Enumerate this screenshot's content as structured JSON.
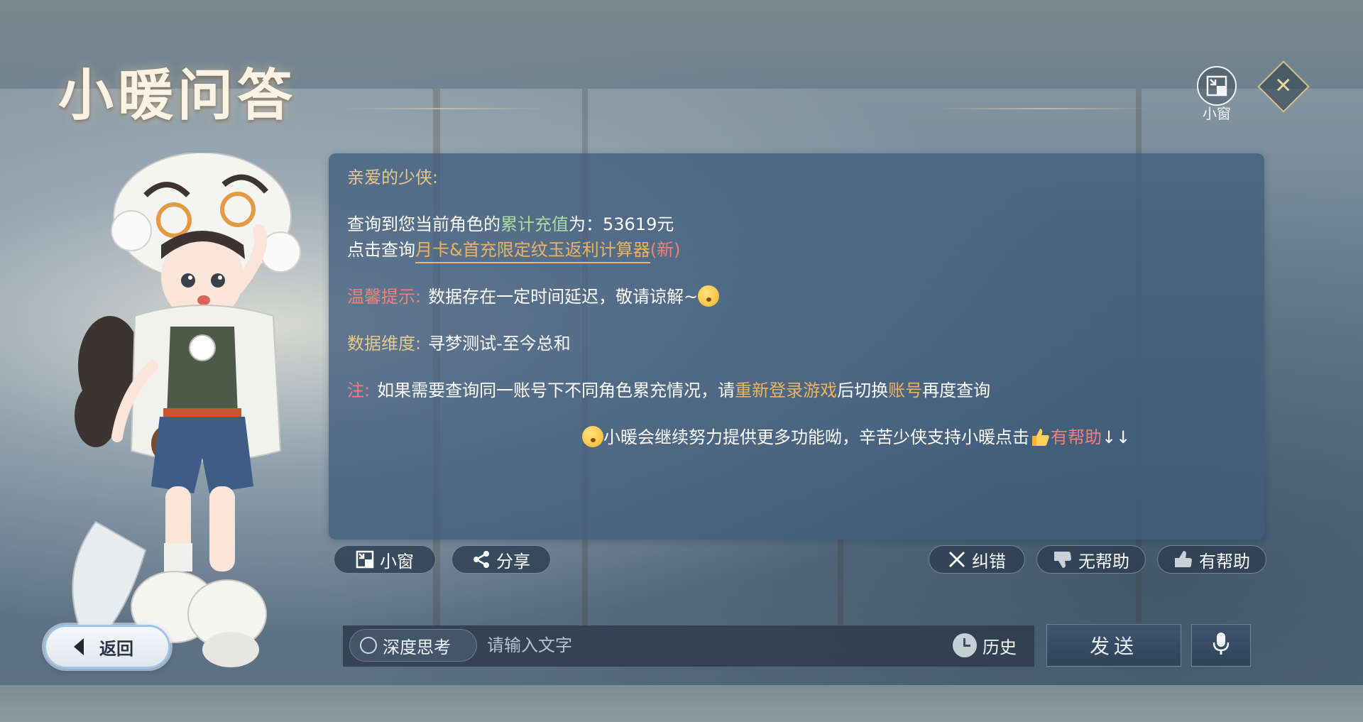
{
  "header": {
    "title": "小暖问答",
    "mini_window_label": "小窗",
    "close_icon": "close-icon"
  },
  "message": {
    "greeting": "亲爱的少侠:",
    "line1": {
      "prefix": "查询到您当前角色的",
      "highlight": "累计充值",
      "middle": "为：",
      "amount": "53619元"
    },
    "line2": {
      "prefix": "点击查询",
      "link": "月卡&首充限定纹玉返利计算器",
      "new_tag": "(新)"
    },
    "tip": {
      "label": "温馨提示:",
      "text": "数据存在一定时间延迟，敬请谅解~"
    },
    "dimension": {
      "label": "数据维度:",
      "text": "寻梦测试-至今总和"
    },
    "note": {
      "label": "注:",
      "part1": "如果需要查询同一账号下不同角色累充情况，请",
      "highlight1": "重新登录游戏",
      "part2": "后切换",
      "highlight2": "账号",
      "part3": "再度查询"
    },
    "footer": {
      "text": "小暖会继续努力提供更多功能呦，辛苦少侠支持小暖点击",
      "helpful": "有帮助",
      "arrows": "↓↓"
    }
  },
  "actions": {
    "mini_window": "小窗",
    "share": "分享",
    "correct": "纠错",
    "not_helpful": "无帮助",
    "helpful": "有帮助"
  },
  "bottom": {
    "back": "返回",
    "deep_think": "深度思考",
    "input_placeholder": "请输入文字",
    "history": "历史",
    "send": "发送"
  },
  "colors": {
    "panel": "#405c7c",
    "gold": "#e5c88c",
    "green": "#a8dca0",
    "red": "#f2807a",
    "orange": "#ecb35f"
  }
}
